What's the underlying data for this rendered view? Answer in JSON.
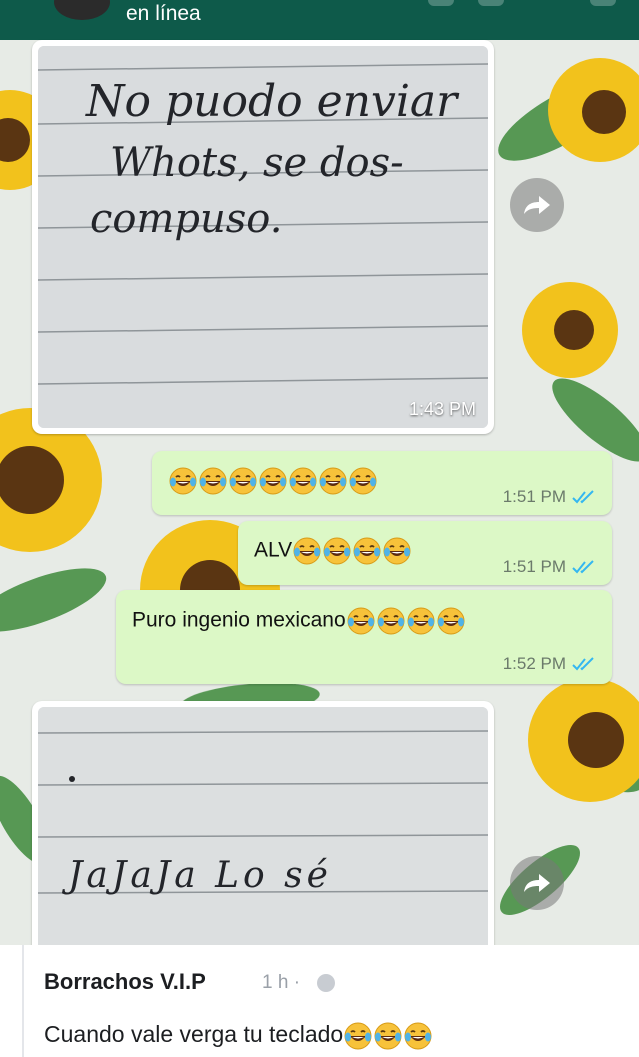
{
  "chat": {
    "contact_status": "en línea",
    "messages": [
      {
        "direction": "incoming",
        "kind": "photo",
        "handwriting": [
          "No puodo enviar",
          "Whots, se dos-",
          "compuso."
        ],
        "time": "1:43 PM"
      },
      {
        "direction": "outgoing",
        "text": "",
        "emoji_count": 7,
        "time": "1:51 PM",
        "status": "read"
      },
      {
        "direction": "outgoing",
        "text": "ALV",
        "emoji_count": 4,
        "time": "1:51 PM",
        "status": "read"
      },
      {
        "direction": "outgoing",
        "text": "Puro ingenio mexicano",
        "emoji_count": 4,
        "time": "1:52 PM",
        "status": "read"
      },
      {
        "direction": "incoming",
        "kind": "photo",
        "handwriting": [
          "JaJaJa Lo sé"
        ]
      }
    ],
    "icons": {
      "forward": "forward-arrow-icon",
      "read_receipt": "double-check-icon",
      "emoji": "laughing-tears-emoji"
    },
    "colors": {
      "header": "#0e5a4a",
      "outgoing_bubble": "#dcf8c6",
      "read_ticks": "#34b7f1"
    }
  },
  "comment": {
    "author": "Borrachos V.I.P",
    "time": "1 h ·",
    "text": "Cuando vale verga tu teclado",
    "emoji_count": 3
  }
}
